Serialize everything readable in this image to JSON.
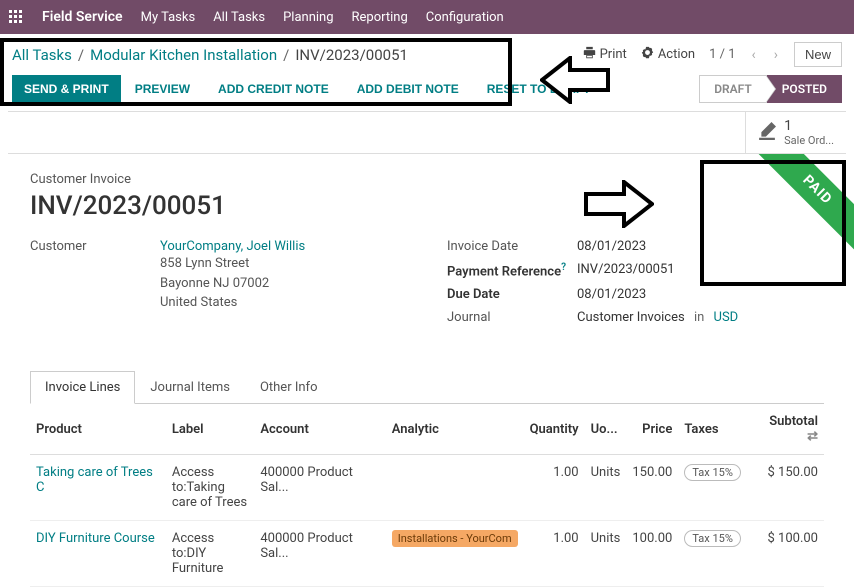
{
  "topbar": {
    "brand": "Field Service",
    "items": [
      "My Tasks",
      "All Tasks",
      "Planning",
      "Reporting",
      "Configuration"
    ]
  },
  "breadcrumb": {
    "root": "All Tasks",
    "parent": "Modular Kitchen Installation",
    "current": "INV/2023/00051"
  },
  "header": {
    "print": "Print",
    "action": "Action",
    "pager": "1 / 1",
    "new": "New"
  },
  "actions": {
    "send_print": "SEND & PRINT",
    "preview": "PREVIEW",
    "add_credit": "ADD CREDIT NOTE",
    "add_debit": "ADD DEBIT NOTE",
    "reset_draft": "RESET TO DRAFT"
  },
  "status": {
    "draft": "DRAFT",
    "posted": "POSTED"
  },
  "smart": {
    "sale_count": "1",
    "sale_label": "Sale Ord..."
  },
  "invoice": {
    "subtitle": "Customer Invoice",
    "name": "INV/2023/00051",
    "ribbon": "PAID",
    "customer_label": "Customer",
    "customer": "YourCompany, Joel Willis",
    "addr1": "858 Lynn Street",
    "addr2": "Bayonne NJ 07002",
    "addr3": "United States",
    "invoice_date_label": "Invoice Date",
    "invoice_date": "08/01/2023",
    "payment_ref_label": "Payment Reference",
    "payment_ref": "INV/2023/00051",
    "due_date_label": "Due Date",
    "due_date": "08/01/2023",
    "journal_label": "Journal",
    "journal": "Customer Invoices",
    "in": "in",
    "currency": "USD"
  },
  "tabs": {
    "lines": "Invoice Lines",
    "journal": "Journal Items",
    "other": "Other Info"
  },
  "table": {
    "headers": {
      "product": "Product",
      "label": "Label",
      "account": "Account",
      "analytic": "Analytic",
      "quantity": "Quantity",
      "uom": "Uo...",
      "price": "Price",
      "taxes": "Taxes",
      "subtotal": "Subtotal"
    },
    "rows": [
      {
        "product": "Taking care of Trees C",
        "label": "Access to:Taking care of Trees",
        "account": "400000 Product Sal...",
        "analytic": "",
        "quantity": "1.00",
        "uom": "Units",
        "price": "150.00",
        "tax": "Tax 15%",
        "subtotal": "$ 150.00"
      },
      {
        "product": "DIY Furniture Course",
        "label": "Access to:DIY Furniture",
        "account": "400000 Product Sal...",
        "analytic": "Installations - YourCom",
        "quantity": "1.00",
        "uom": "Units",
        "price": "100.00",
        "tax": "Tax 15%",
        "subtotal": "$ 100.00"
      }
    ]
  }
}
